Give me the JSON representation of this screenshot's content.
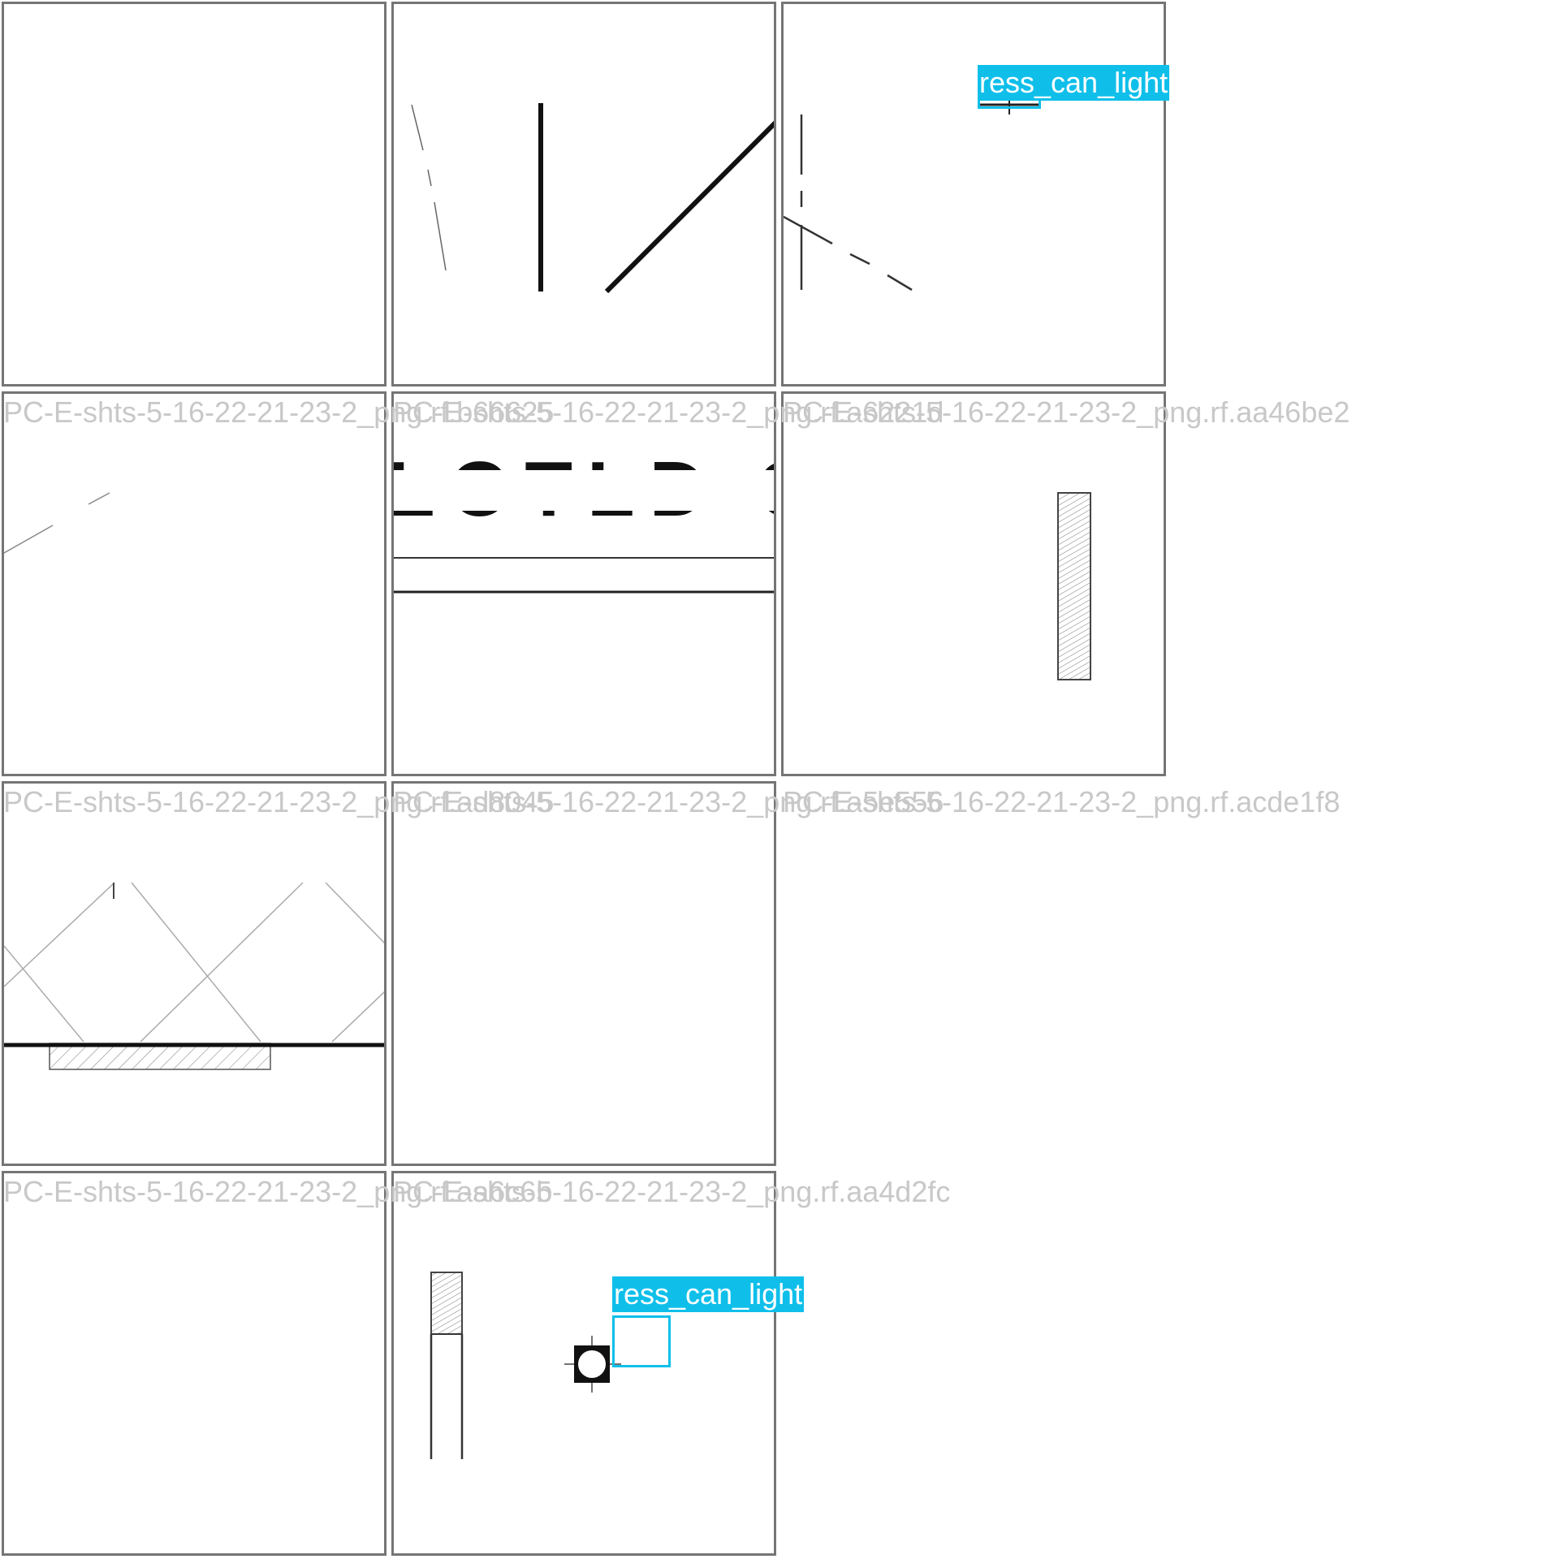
{
  "tiles": [
    {
      "caption": ""
    },
    {
      "caption": ""
    },
    {
      "caption": ""
    },
    {
      "caption": "PC-E-shts-5-16-22-21-23-2_png.rf.b66625"
    },
    {
      "caption": "PC-E-shts-5-16-22-21-23-2_png.rf.a6221d"
    },
    {
      "caption": "PC-E-shts-5-16-22-21-23-2_png.rf.aa46be2"
    },
    {
      "caption": "PC-E-shts-5-16-22-21-23-2_png.rf.ad8045"
    },
    {
      "caption": "PC-E-shts-5-16-22-21-23-2_png.rf.a5e556"
    },
    {
      "caption": "PC-E-shts-5-16-22-21-23-2_png.rf.acde1f8"
    },
    {
      "caption": "PC-E-shts-5-16-22-21-23-2_png.rf.aa6c6b"
    },
    {
      "caption": "PC-E-shts-5-16-22-21-23-2_png.rf.aa4d2fc"
    }
  ],
  "detections": [
    {
      "label": "ress_can_light",
      "color": "#0fbfea"
    },
    {
      "label": "ress_can_light",
      "color": "#0fbfea"
    }
  ],
  "fragment_text": "LOTLD OL",
  "colors": {
    "tile_border": "#757575",
    "caption": "#c8c8c8",
    "detection": "#0fbfea"
  }
}
